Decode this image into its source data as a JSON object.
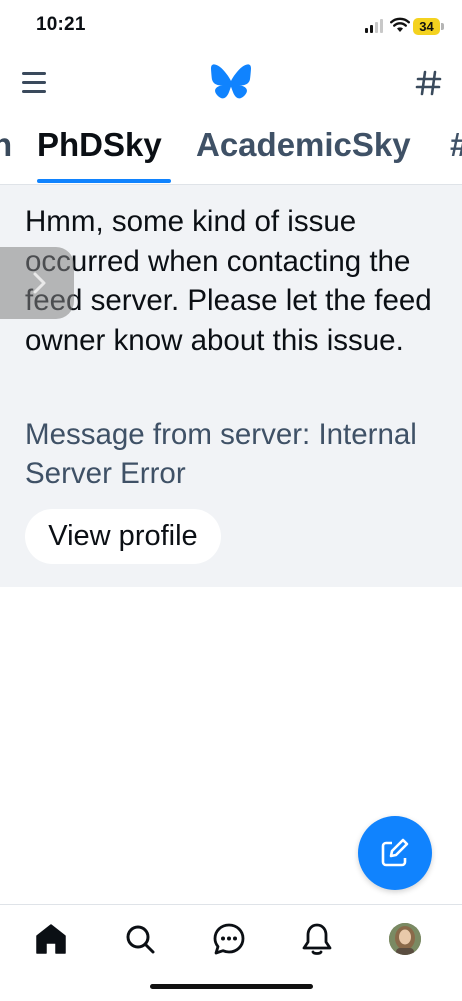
{
  "status_bar": {
    "time": "10:21",
    "battery": "34"
  },
  "header": {
    "menu_icon": "hamburger-menu-icon",
    "logo_icon": "butterfly-logo-icon",
    "feeds_icon": "hashtag-icon"
  },
  "tabs": [
    {
      "label": "n"
    },
    {
      "label": "PhDSky",
      "selected": true
    },
    {
      "label": "AcademicSky"
    },
    {
      "label": "#"
    }
  ],
  "error": {
    "message": "Hmm, some kind of issue occurred when contacting the feed server. Please let the feed owner know about this issue.",
    "server_message": "Message from server: Internal Server Error",
    "button_label": "View profile"
  },
  "colors": {
    "accent": "#1083fe",
    "panel_bg": "#f1f3f6",
    "muted_text": "#3f5166"
  },
  "bottom_nav": [
    {
      "name": "home",
      "icon": "home-icon",
      "selected": true
    },
    {
      "name": "search",
      "icon": "search-icon"
    },
    {
      "name": "chat",
      "icon": "chat-icon"
    },
    {
      "name": "notifications",
      "icon": "bell-icon"
    },
    {
      "name": "profile",
      "icon": "avatar"
    }
  ]
}
